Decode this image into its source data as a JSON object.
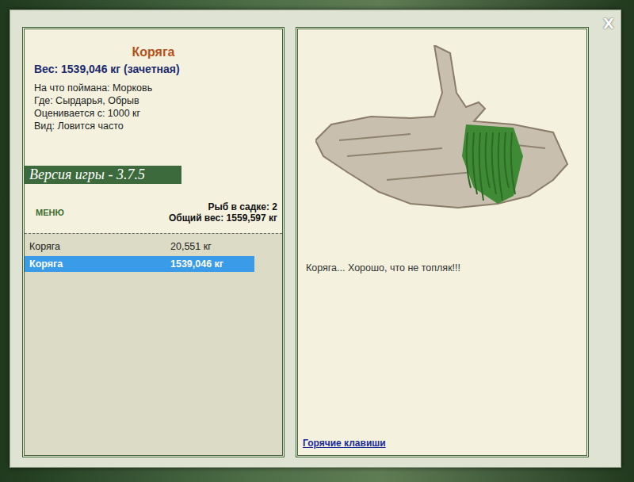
{
  "window": {
    "close": "X"
  },
  "fish": {
    "name": "Коряга",
    "weight": "Вес: 1539,046 кг (зачетная)",
    "details": [
      "На что поймана: Морковь",
      "Где: Сырдарья, Обрыв",
      "Оценивается с: 1000 кг",
      "Вид: Ловится часто"
    ],
    "description": "Коряга... Хорошо, что не топляк!!!"
  },
  "version": "Версия игры - 3.7.5",
  "menu_button": "МЕНЮ",
  "keepnet": {
    "count": "Рыб в садке: 2",
    "total": "Общий вес: 1559,597 кг"
  },
  "catch_list": [
    {
      "name": "Коряга",
      "weight": "20,551 кг",
      "selected": false
    },
    {
      "name": "Коряга",
      "weight": "1539,046 кг",
      "selected": true
    }
  ],
  "hotkeys_link": "Горячие клавиши"
}
